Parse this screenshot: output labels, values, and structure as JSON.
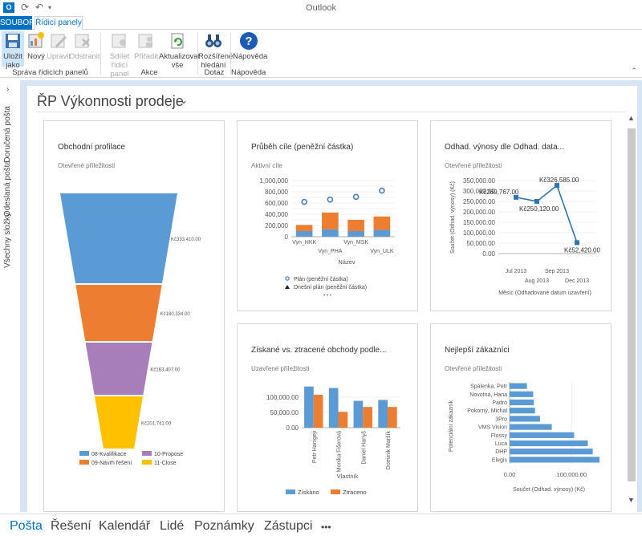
{
  "window": {
    "title": "Outlook"
  },
  "tabs": {
    "file": "SOUBOR",
    "active": "Řídicí panely"
  },
  "ribbon": {
    "buttons": {
      "save_as": "Uložit jako",
      "new": "Nový",
      "edit": "Upravit",
      "delete": "Odstranit",
      "share": "Sdílet řídicí panel",
      "assign": "Přiřadit",
      "refresh": "Aktualizovat vše",
      "advanced_find": "Rozšířené hledání",
      "help": "Nápověda"
    },
    "groups": {
      "manage": "Správa řídicích panelů",
      "actions": "Akce",
      "query": "Dotaz",
      "help": "Nápověda"
    }
  },
  "left_rail": {
    "inbox": "Doručená pošta",
    "sent": "Odeslaná pošta",
    "all": "Všechny složky"
  },
  "dashboard": {
    "title": "ŘP Výkonnosti prodeje"
  },
  "panels": {
    "funnel": {
      "title": "Obchodní profilace",
      "subtitle": "Otevřené příležitosti"
    },
    "goal": {
      "title": "Průběh cíle (peněžní částka)",
      "subtitle": "Aktivní cíle"
    },
    "revenue": {
      "title": "Odhad. výnosy dle Odhad. data...",
      "subtitle": "Otevřené příležitosti"
    },
    "wonlost": {
      "title": "Získané vs. ztracené obchody podle...",
      "subtitle": "Uzavřené příležitosti"
    },
    "customers": {
      "title": "Nejlepší zákazníci",
      "subtitle": "Otevřené příležitosti"
    }
  },
  "bottom_nav": {
    "mail": "Pošta",
    "solutions": "Řešení",
    "calendar": "Kalendář",
    "people": "Lidé",
    "notes": "Poznámky",
    "reps": "Zástupci",
    "more": "•••"
  },
  "chart_data": [
    {
      "type": "funnel",
      "categories": [
        "08-Kvalifikace",
        "09-Návrh řešení",
        "10-Propose",
        "11-Close"
      ],
      "values": [
        333410.0,
        180334.0,
        183407.0,
        201741.0
      ],
      "labels": [
        "Kč333,410.00",
        "Kč180,334.00",
        "Kč183,407.00",
        "Kč201,741.00"
      ],
      "colors": [
        "#5b9bd5",
        "#ed7d31",
        "#a77dba",
        "#ffc000"
      ],
      "legend": "bottom"
    },
    {
      "type": "bar",
      "categories": [
        "Vyn_HKK",
        "Vyn_PHA",
        "Vyn_MSK",
        "Vyn_ULK"
      ],
      "series": [
        {
          "name": "",
          "values": [
            100000,
            130000,
            100000,
            120000
          ],
          "color": "#5b9bd5"
        },
        {
          "name": "",
          "values": [
            110000,
            300000,
            200000,
            240000
          ],
          "color": "#ed7d31"
        },
        {
          "name": "Plán (peněžní částka)",
          "values": [
            620000,
            660000,
            710000,
            820000
          ],
          "color": "#4a7ebb",
          "marker": "circle"
        }
      ],
      "yticks": [
        "0",
        "100,000",
        "200,000",
        "300,000",
        "400,000",
        "500,000",
        "600,000",
        "700,000",
        "800,000",
        "900,000",
        "1,000,000"
      ],
      "ylim": [
        0,
        1000000
      ],
      "xlabel": "Název",
      "legend_extra": "Dnešní plán (peněžní částka)",
      "legend_more": "• • •"
    },
    {
      "type": "line",
      "x": [
        "Jul 2013",
        "Aug 2013",
        "Sep 2013",
        "Dec 2013"
      ],
      "values": [
        269767.0,
        250120.0,
        326585.0,
        52420.0
      ],
      "labels": [
        "Kč269,767.00",
        "Kč250,120.00",
        "Kč326,585.00",
        "Kč52,420.00"
      ],
      "yticks": [
        "0.00",
        "50,000.00",
        "100,000.00",
        "150,000.00",
        "200,000.00",
        "250,000.00",
        "300,000.00",
        "350,000.00"
      ],
      "ylim": [
        0,
        350000
      ],
      "xlabel": "Měsíc (Odhadované datum uzavření)",
      "ylabel": "Součet (Odhad. výnosy) (Kč)",
      "color": "#2e75b6"
    },
    {
      "type": "bar",
      "categories": [
        "Petr Hanigeji",
        "Monika Fišerová",
        "Daniel Hanyš",
        "Dominik Maršík"
      ],
      "series": [
        {
          "name": "Získáno",
          "values": [
            135000,
            130000,
            88000,
            91000
          ],
          "color": "#5b9bd5"
        },
        {
          "name": "Ztraceno",
          "values": [
            108000,
            52000,
            68000,
            68000
          ],
          "color": "#ed7d31"
        }
      ],
      "yticks": [
        "0.00",
        "50,000.00",
        "100,000.00"
      ],
      "ylim": [
        0,
        150000
      ],
      "xlabel": "Vlastník",
      "legend": "bottom"
    },
    {
      "type": "bar",
      "orientation": "horizontal",
      "categories": [
        "Spálenka, Petr",
        "Novotná, Hana",
        "Padro",
        "Pokorný, Michal",
        "3Pro",
        "VMS Vision",
        "Flossy",
        "Luca",
        "DHP",
        "Elegis"
      ],
      "values": [
        28000,
        38000,
        39000,
        41000,
        49000,
        68000,
        104000,
        126000,
        134000,
        145000
      ],
      "xticks": [
        "0.00",
        "100,000.00"
      ],
      "xlim": [
        0,
        150000
      ],
      "xlabel": "Součet (Odhad. výnosy) (Kč)",
      "ylabel": "Potenciální zákazník",
      "color": "#5b9bd5"
    }
  ]
}
